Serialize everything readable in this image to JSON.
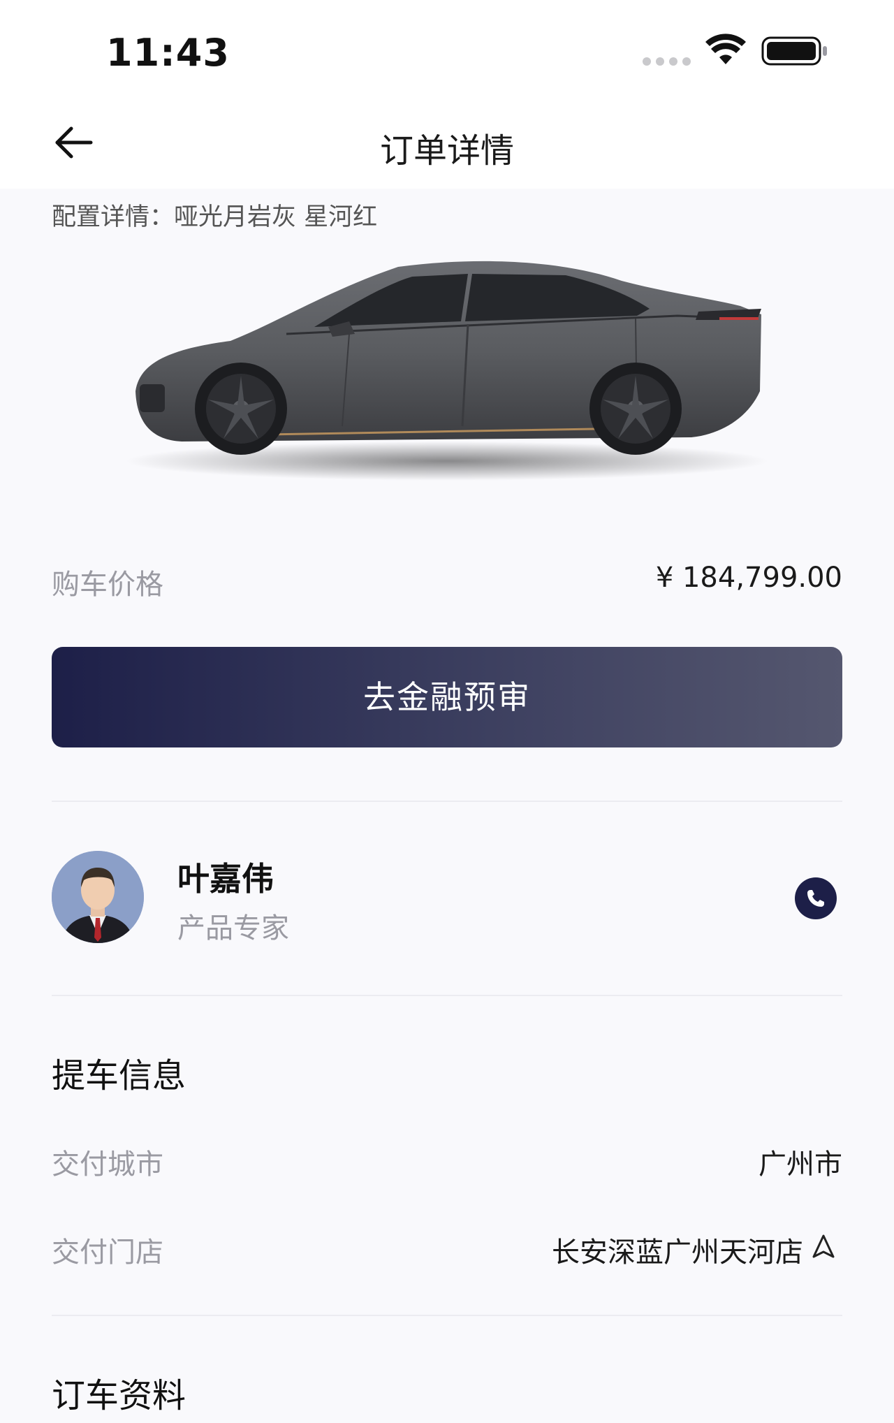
{
  "status_bar": {
    "time": "11:43",
    "icons": [
      "cellular-dots-icon",
      "wifi-icon",
      "battery-icon"
    ]
  },
  "header": {
    "title": "订单详情",
    "back_icon": "arrow-left-icon"
  },
  "config": {
    "text": "配置详情：哑光月岩灰 星河红"
  },
  "car": {
    "color_body": "#5b5d61",
    "image": "car-side-view"
  },
  "price": {
    "label": "购车价格",
    "value": "¥ 184,799.00"
  },
  "finance_button": {
    "label": "去金融预审"
  },
  "advisor": {
    "name": "叶嘉伟",
    "role": "产品专家",
    "call_icon": "phone-icon"
  },
  "pickup": {
    "title": "提车信息",
    "city_label": "交付城市",
    "city_value": "广州市",
    "store_label": "交付门店",
    "store_value": "长安深蓝广州天河店",
    "store_icon": "navigation-arrow-icon"
  },
  "order_docs": {
    "title": "订车资料"
  },
  "colors": {
    "accent": "#1d1f48",
    "muted_text": "#9a9aa2",
    "background": "#f9f9fc"
  }
}
